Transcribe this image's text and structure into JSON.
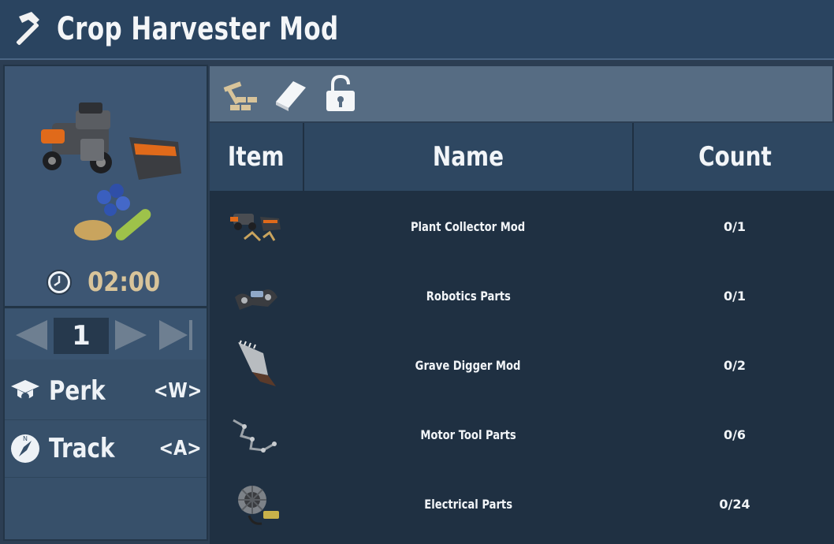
{
  "window": {
    "title": "Crop Harvester Mod",
    "title_icon": "hammer-icon"
  },
  "recipe": {
    "craft_time": "02:00",
    "quantity": "1",
    "actions": [
      {
        "label": "Perk",
        "key": "<W>",
        "icon": "graduation-cap-icon"
      },
      {
        "label": "Track",
        "key": "<A>",
        "icon": "compass-icon"
      }
    ]
  },
  "tabs": [
    {
      "icon": "crafting-hammer-bricks-icon",
      "active": true
    },
    {
      "icon": "book-icon",
      "active": false
    },
    {
      "icon": "unlocked-padlock-icon",
      "active": false
    }
  ],
  "table": {
    "headers": [
      "Item",
      "Name",
      "Count"
    ],
    "rows": [
      {
        "name": "Plant Collector Mod",
        "count": "0/1",
        "icon": "plant-collector-mod-icon"
      },
      {
        "name": "Robotics Parts",
        "count": "0/1",
        "icon": "robotics-parts-icon"
      },
      {
        "name": "Grave Digger Mod",
        "count": "0/2",
        "icon": "grave-digger-mod-icon"
      },
      {
        "name": "Motor Tool Parts",
        "count": "0/6",
        "icon": "motor-tool-parts-icon"
      },
      {
        "name": "Electrical Parts",
        "count": "0/24",
        "icon": "electrical-parts-icon"
      }
    ]
  },
  "colors": {
    "accent": "#d8c49a",
    "header_bg": "#2a4460",
    "cell_bg": "#5a7089"
  }
}
